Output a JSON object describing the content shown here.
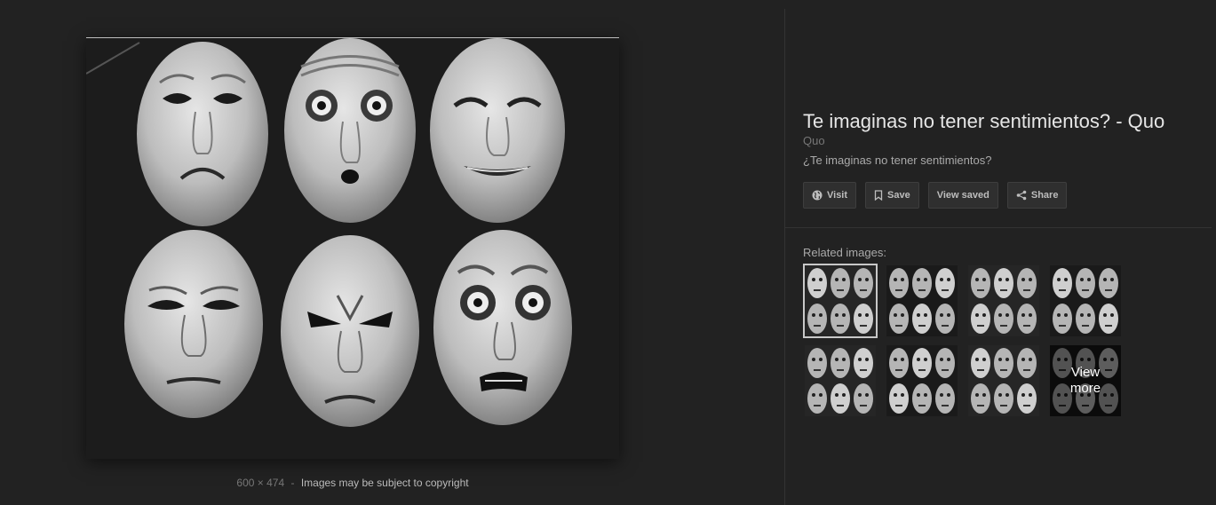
{
  "image": {
    "dimensions": "600 × 474",
    "separator": "-",
    "copyright_notice": "Images may be subject to copyright"
  },
  "panel": {
    "title": "Te imaginas no tener sentimientos? - Quo",
    "source": "Quo",
    "description": "¿Te imaginas no tener sentimientos?",
    "actions": {
      "visit": "Visit",
      "save": "Save",
      "view_saved": "View saved",
      "share": "Share"
    },
    "related_label": "Related images:",
    "view_more_line1": "View",
    "view_more_line2": "more"
  },
  "icons": {
    "visit": "globe-icon",
    "save": "bookmark-icon",
    "share": "share-icon"
  }
}
